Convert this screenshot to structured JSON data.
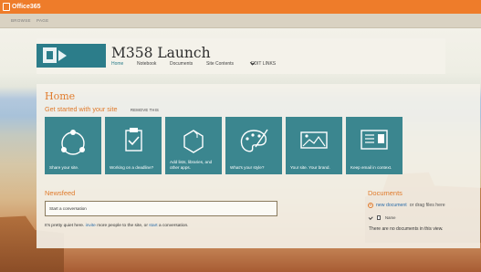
{
  "suite_bar": {
    "brand": "Office365"
  },
  "ribbon": {
    "tabs": [
      "BROWSE",
      "PAGE"
    ]
  },
  "site": {
    "title": "M358 Launch",
    "nav": [
      "Home",
      "Notebook",
      "Documents",
      "Site Contents"
    ],
    "edit_links": "EDIT LINKS"
  },
  "page": {
    "title": "Home",
    "getting_started": "Get started with your site",
    "remove_this": "REMOVE THIS"
  },
  "tiles": [
    {
      "label": "Share your site.",
      "icon": "share-icon"
    },
    {
      "label": "Working on a deadline?",
      "icon": "clipboard-check-icon"
    },
    {
      "label": "Add lists, libraries, and other apps.",
      "icon": "apps-hexagon-icon"
    },
    {
      "label": "What's your style?",
      "icon": "palette-icon"
    },
    {
      "label": "Your site. Your brand.",
      "icon": "image-icon"
    },
    {
      "label": "Keep email in context.",
      "icon": "mail-icon"
    }
  ],
  "newsfeed": {
    "heading": "Newsfeed",
    "placeholder": "Start a conversation",
    "quiet_text_1": "It's pretty quiet here.",
    "invite_link": "invite",
    "quiet_text_2": "more people to the site, or",
    "start_link": "start",
    "quiet_text_3": "a conversation."
  },
  "documents": {
    "heading": "Documents",
    "new_link": "new document",
    "drag_text": "or drag files here",
    "column_name": "Name",
    "empty": "There are no documents in this view."
  },
  "colors": {
    "suite_bar": "#ee7c2a",
    "accent_orange": "#e07b2c",
    "tile_teal": "#3b868f",
    "link_blue": "#2b6ca8"
  }
}
